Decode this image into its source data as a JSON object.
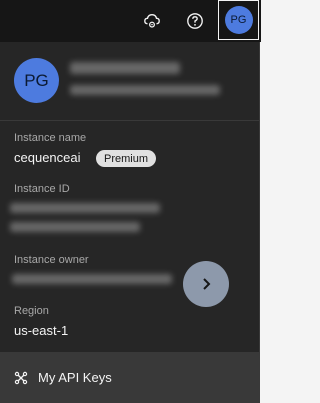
{
  "header": {
    "avatar_initials": "PG",
    "icons": [
      "cloud-settings-icon",
      "help-icon"
    ]
  },
  "profile": {
    "avatar_initials": "PG"
  },
  "instance": {
    "name_label": "Instance name",
    "name_value": "cequenceai",
    "plan_badge": "Premium",
    "id_label": "Instance ID",
    "owner_label": "Instance owner",
    "region_label": "Region",
    "region_value": "us-east-1"
  },
  "footer": {
    "api_keys_label": "My API Keys"
  },
  "colors": {
    "header_bg": "#161616",
    "panel_bg": "#262626",
    "avatar": "#4d7bdf",
    "footer_bg": "#393939"
  }
}
